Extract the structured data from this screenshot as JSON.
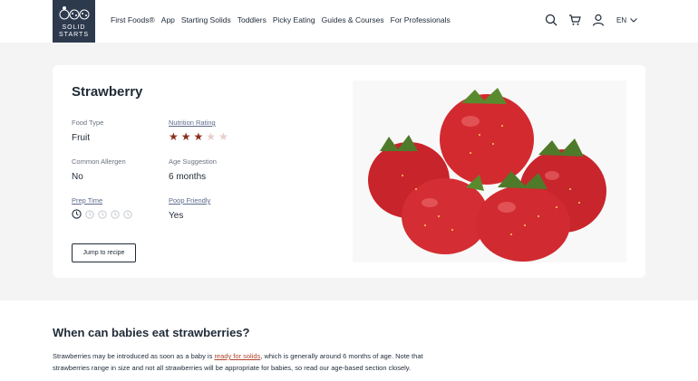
{
  "logo": {
    "line1": "SOLID",
    "line2": "STARTS"
  },
  "nav": {
    "items": [
      "First Foods®",
      "App",
      "Starting Solids",
      "Toddlers",
      "Picky Eating",
      "Guides & Courses",
      "For Professionals"
    ]
  },
  "header": {
    "icons": [
      "search-icon",
      "cart-icon",
      "user-icon"
    ],
    "language": "EN"
  },
  "food": {
    "title": "Strawberry",
    "food_type_label": "Food Type",
    "food_type_value": "Fruit",
    "nutrition_label": "Nutrition Rating",
    "nutrition_rating": 3,
    "nutrition_max": 5,
    "allergen_label": "Common Allergen",
    "allergen_value": "No",
    "age_label": "Age Suggestion",
    "age_value": "6 months",
    "prep_label": "Prep Time",
    "prep_level": 1,
    "prep_max": 5,
    "poop_label": "Poop Friendly",
    "poop_value": "Yes",
    "jump_button": "Jump to recipe"
  },
  "colors": {
    "star_filled": "#8b2e1f",
    "star_empty": "#e8cfca",
    "link": "#b0442f",
    "logo_bg": "#2d3a4e"
  },
  "article": {
    "heading": "When can babies eat strawberries?",
    "para_before_link": "Strawberries may be introduced as soon as a baby is ",
    "para_link": "ready for solids",
    "para_after_link": ", which is generally around 6 months of age. Note that strawberries range in size and not all strawberries will be appropriate for babies, so read our age-based section closely."
  }
}
